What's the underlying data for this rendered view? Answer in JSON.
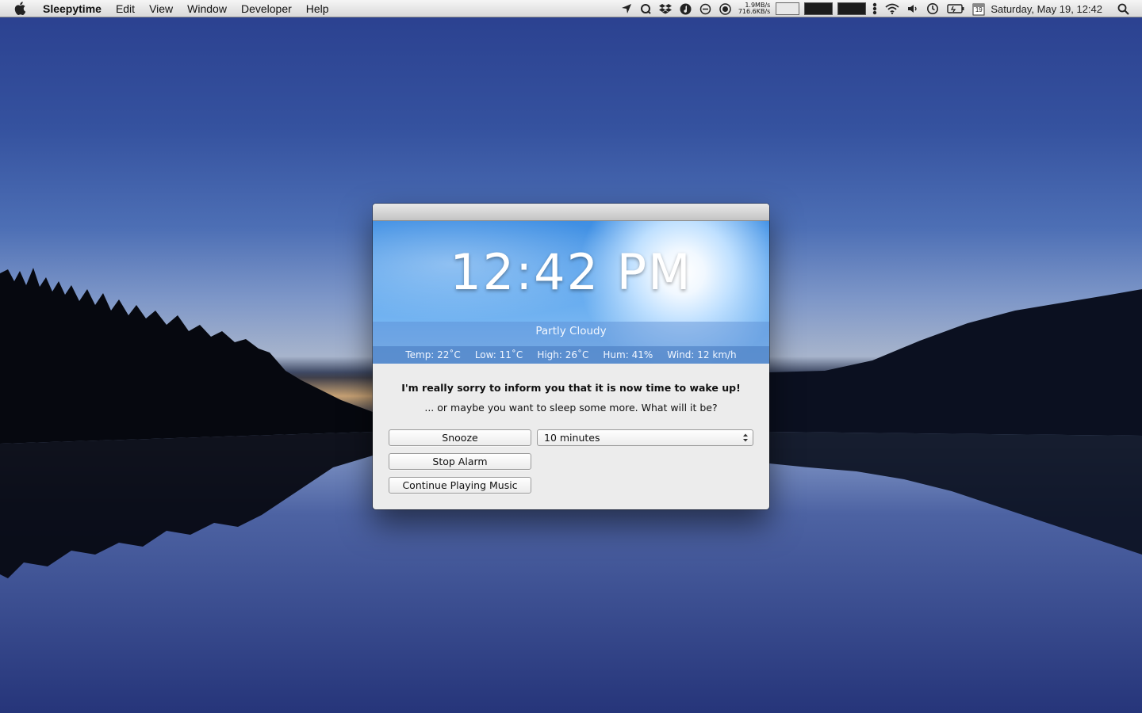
{
  "menubar": {
    "app_name": "Sleepytime",
    "items": [
      "Edit",
      "View",
      "Window",
      "Developer",
      "Help"
    ],
    "network": {
      "down": "1.9MB/s",
      "up": "716.6KB/s"
    },
    "calendar_day": "19",
    "datetime": "Saturday, May 19, 12:42"
  },
  "weather": {
    "time": "12:42 PM",
    "condition": "Partly Cloudy",
    "temp": "Temp: 22˚C",
    "low": "Low: 11˚C",
    "high": "High: 26˚C",
    "humidity": "Hum: 41%",
    "wind": "Wind: 12 km/h"
  },
  "alarm": {
    "message_primary": "I'm really sorry to inform you that it is now time to wake up!",
    "message_secondary": "... or maybe you want to sleep some more. What will it be?",
    "snooze_label": "Snooze",
    "snooze_duration": "10 minutes",
    "stop_label": "Stop Alarm",
    "continue_label": "Continue Playing Music"
  }
}
